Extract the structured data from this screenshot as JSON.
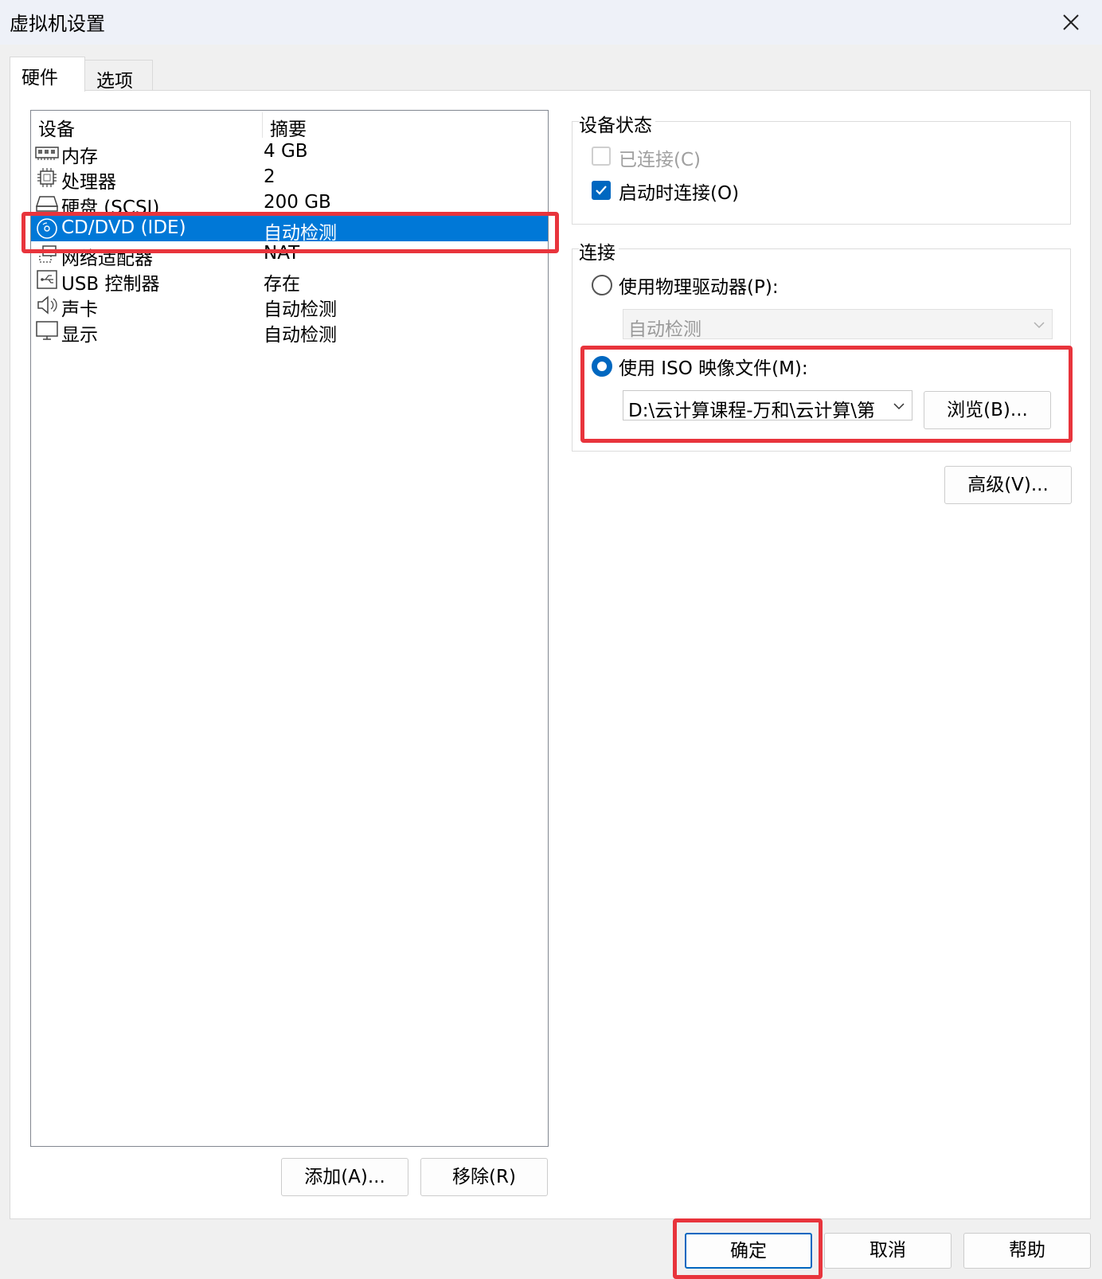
{
  "window": {
    "title": "虚拟机设置"
  },
  "tabs": [
    {
      "label": "硬件",
      "active": true
    },
    {
      "label": "选项",
      "active": false
    }
  ],
  "device_list": {
    "columns": [
      "设备",
      "摘要"
    ],
    "rows": [
      {
        "device": "内存",
        "summary": "4 GB",
        "icon": "memory-icon"
      },
      {
        "device": "处理器",
        "summary": "2",
        "icon": "processor-icon"
      },
      {
        "device": "硬盘 (SCSI)",
        "summary": "200 GB",
        "icon": "hard-disk-icon"
      },
      {
        "device": "CD/DVD (IDE)",
        "summary": "自动检测",
        "icon": "cd-dvd-icon",
        "selected": true
      },
      {
        "device": "网络适配器",
        "summary": "NAT",
        "icon": "network-adapter-icon"
      },
      {
        "device": "USB 控制器",
        "summary": "存在",
        "icon": "usb-icon"
      },
      {
        "device": "声卡",
        "summary": "自动检测",
        "icon": "speaker-icon"
      },
      {
        "device": "显示",
        "summary": "自动检测",
        "icon": "monitor-icon"
      }
    ]
  },
  "list_buttons": {
    "add": "添加(A)...",
    "remove": "移除(R)"
  },
  "device_status": {
    "title": "设备状态",
    "connected": {
      "label": "已连接(C)",
      "checked": false,
      "disabled": true
    },
    "connect_at_power_on": {
      "label": "启动时连接(O)",
      "checked": true
    }
  },
  "connection": {
    "title": "连接",
    "physical_drive": {
      "label": "使用物理驱动器(P):",
      "selected": false,
      "value": "自动检测"
    },
    "iso_image": {
      "label": "使用 ISO 映像文件(M):",
      "selected": true,
      "value": "D:\\云计算课程-万和\\云计算\\第"
    },
    "browse": "浏览(B)..."
  },
  "advanced": "高级(V)...",
  "footer": {
    "ok": "确定",
    "cancel": "取消",
    "help": "帮助"
  },
  "colors": {
    "accent": "#0067c0",
    "selection": "#0078d7",
    "highlight": "#e8343c"
  }
}
